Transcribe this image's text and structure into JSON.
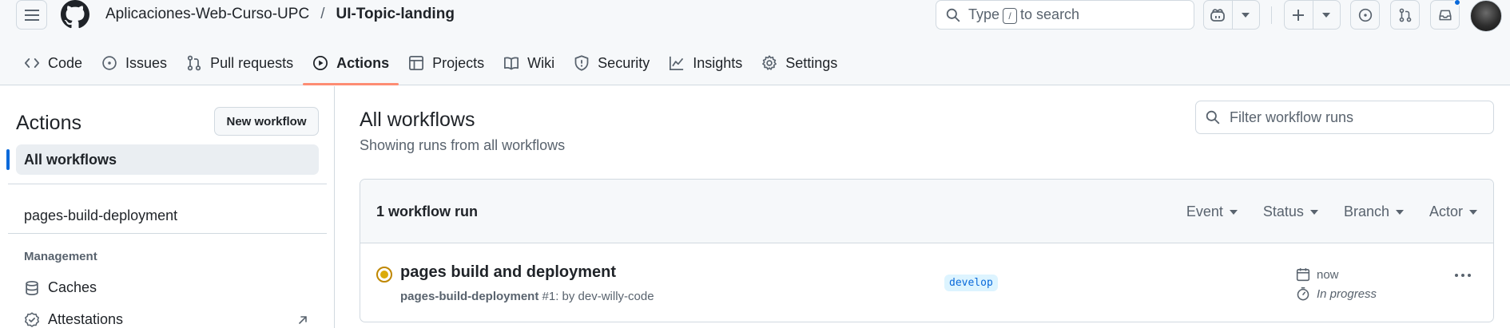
{
  "header": {
    "owner": "Aplicaciones-Web-Curso-UPC",
    "separator": "/",
    "repo": "UI-Topic-landing",
    "search": {
      "prefix": "Type",
      "key": "/",
      "suffix": "to search"
    }
  },
  "nav": {
    "tabs": [
      {
        "label": "Code",
        "icon": "code-icon"
      },
      {
        "label": "Issues",
        "icon": "issue-icon"
      },
      {
        "label": "Pull requests",
        "icon": "pull-request-icon"
      },
      {
        "label": "Actions",
        "icon": "play-icon",
        "active": true
      },
      {
        "label": "Projects",
        "icon": "table-icon"
      },
      {
        "label": "Wiki",
        "icon": "book-icon"
      },
      {
        "label": "Security",
        "icon": "shield-icon"
      },
      {
        "label": "Insights",
        "icon": "graph-icon"
      },
      {
        "label": "Settings",
        "icon": "gear-icon"
      }
    ]
  },
  "sidebar": {
    "title": "Actions",
    "new_workflow": "New workflow",
    "all_workflows": "All workflows",
    "workflows": [
      "pages-build-deployment"
    ],
    "management_heading": "Management",
    "management_items": [
      {
        "label": "Caches",
        "icon": "database-icon"
      },
      {
        "label": "Attestations",
        "icon": "verified-icon"
      }
    ]
  },
  "main": {
    "title": "All workflows",
    "subtitle": "Showing runs from all workflows",
    "filter_placeholder": "Filter workflow runs",
    "run_count": "1 workflow run",
    "filters": [
      "Event",
      "Status",
      "Branch",
      "Actor"
    ],
    "runs": [
      {
        "title": "pages build and deployment",
        "workflow": "pages-build-deployment",
        "meta": "#1: by dev-willy-code",
        "branch": "develop",
        "time": "now",
        "duration": "In progress",
        "status_color": "#dbab0a"
      }
    ]
  },
  "colors": {
    "accent": "#0969da",
    "active_tab_underline": "#fd8c73",
    "in_progress": "#bf8700"
  }
}
